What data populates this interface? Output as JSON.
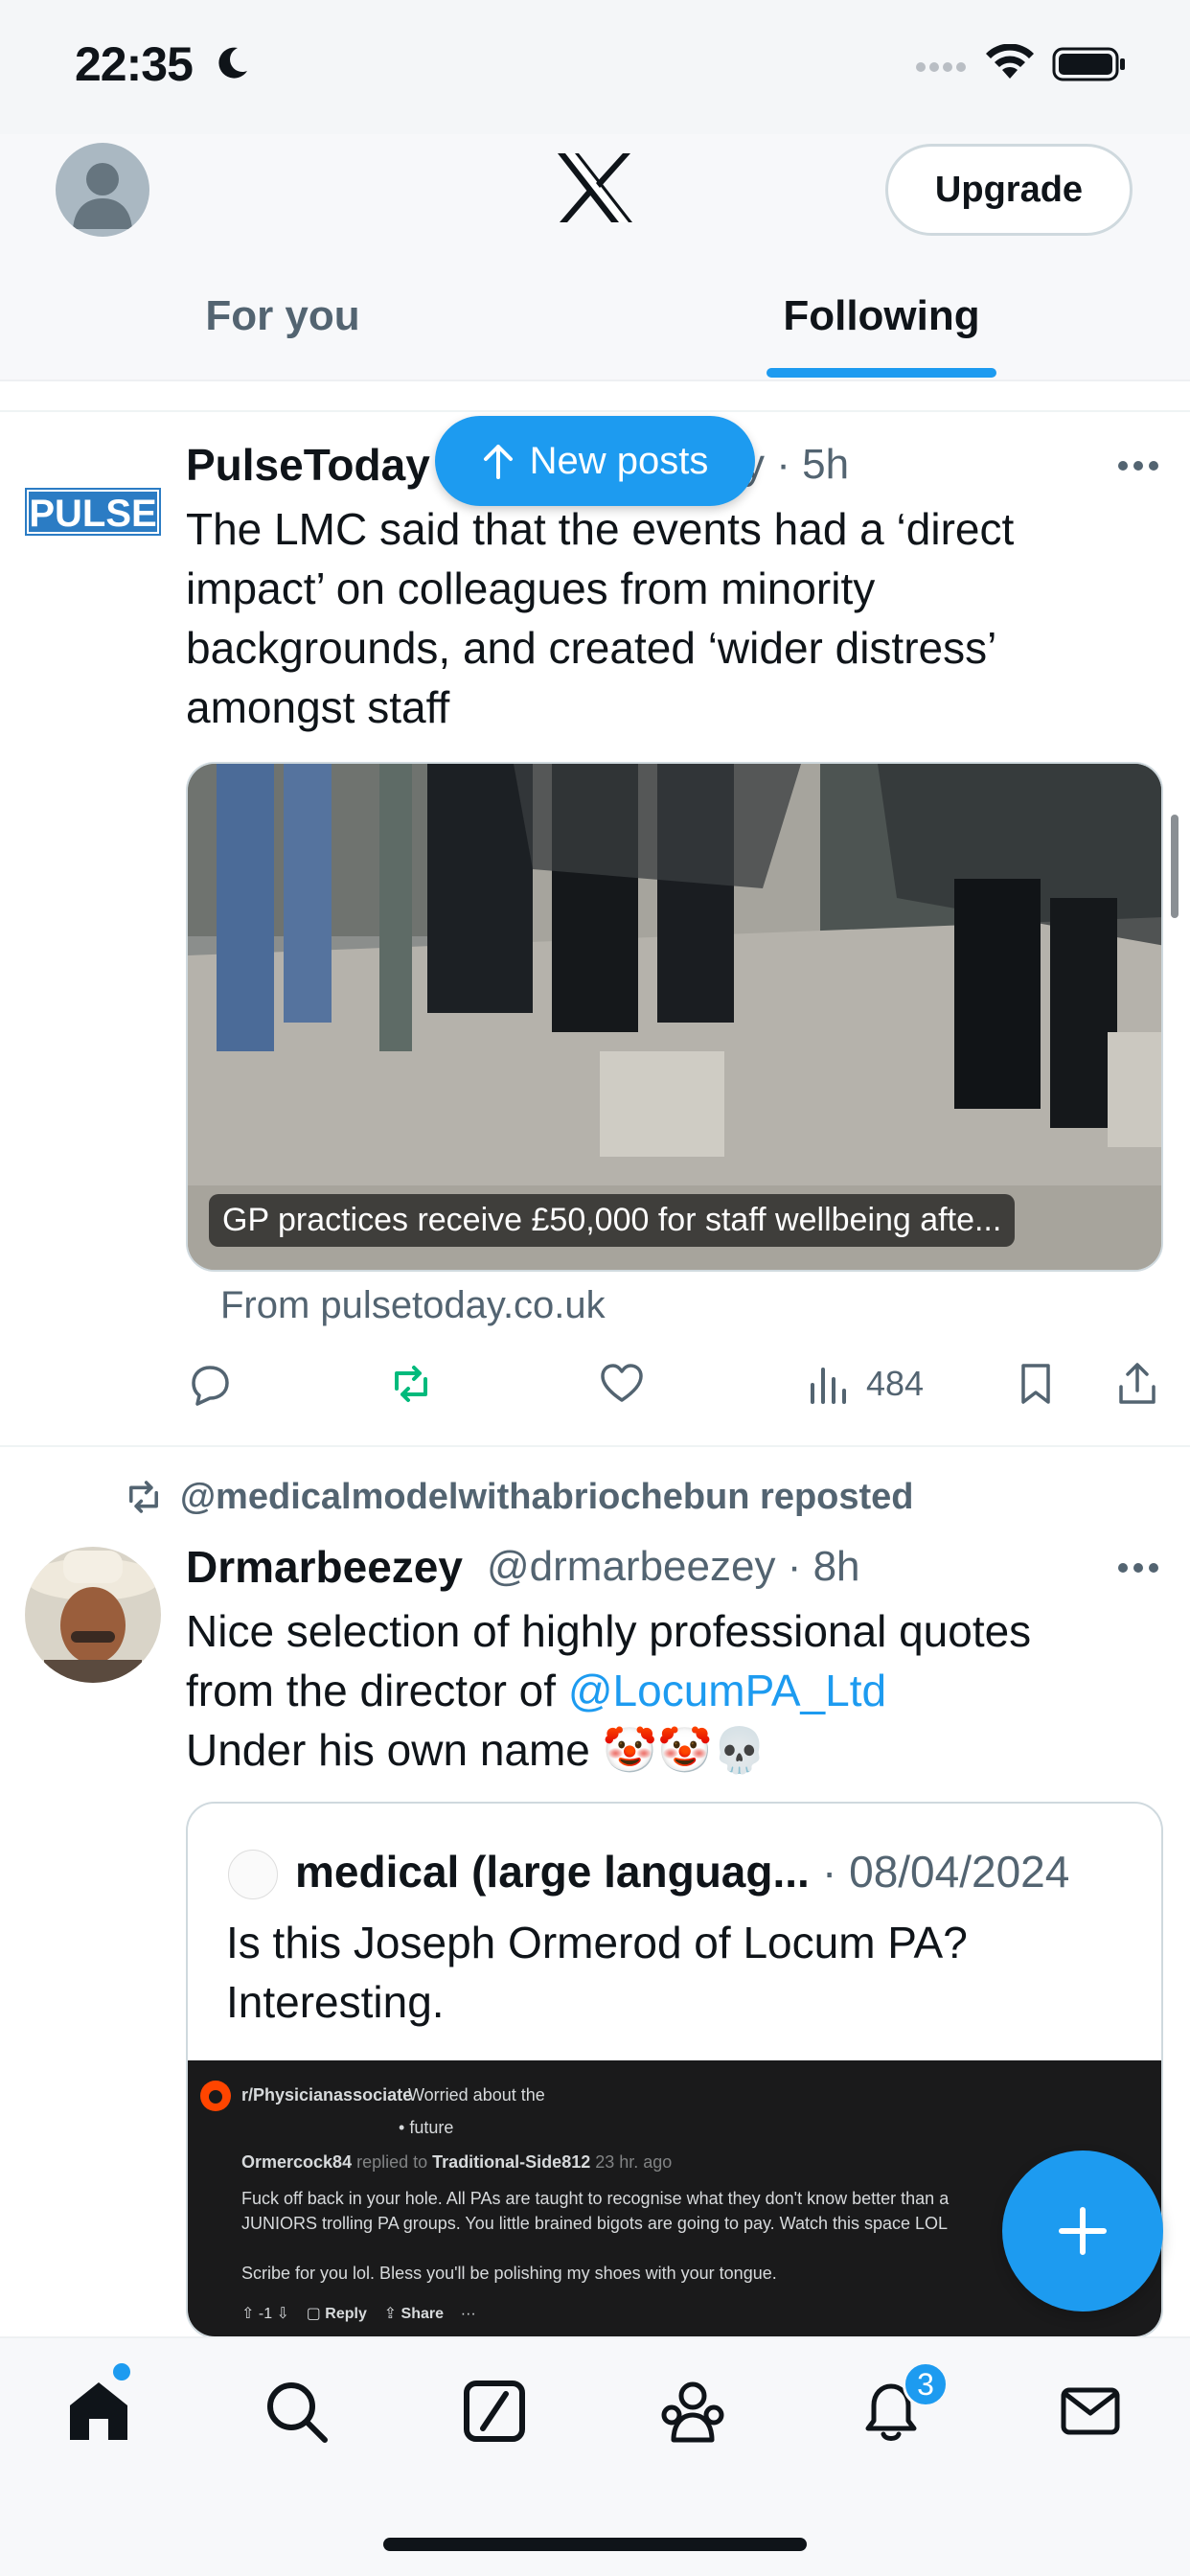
{
  "status_bar": {
    "time": "22:35"
  },
  "header": {
    "upgrade_label": "Upgrade",
    "tabs": [
      {
        "label": "For you",
        "selected": false
      },
      {
        "label": "Following",
        "selected": true
      }
    ]
  },
  "new_posts_label": "New posts",
  "tweets": [
    {
      "display_name": "PulseToday",
      "handle_partial": "y",
      "time": "5h",
      "text": "The LMC said that the events had a ‘direct impact’ on colleagues from minority backgrounds, and created ‘wider distress’ amongst staff",
      "avatar_text": "PULSE",
      "media_caption": "GP practices receive £50,000 for staff wellbeing afte...",
      "from_link": "From pulsetoday.co.uk",
      "views": "484"
    },
    {
      "reposted_by": "@medicalmodelwithabriochebun reposted",
      "display_name": "Drmarbeezey",
      "handle": "@drmarbeezey",
      "time": "8h",
      "text_line1": "Nice selection of highly professional quotes",
      "text_line2_prefix": "from the director of ",
      "mention": "@LocumPA_Ltd",
      "text_line3": "Under his own name 🤡🤡💀",
      "quote": {
        "display_name": "medical (large languag...",
        "date": "08/04/2024",
        "text": "Is this Joseph Ormerod of Locum PA? Interesting.",
        "screenshot": {
          "subreddit": "r/Physicianassociate",
          "thread_title_1": "Worried about the",
          "thread_title_2": "future",
          "user": "Ormercock84",
          "replied_to_prefix": "replied to",
          "replied_to": "Traditional-Side812",
          "age": "23 hr. ago",
          "body_1": "Fuck off back in your hole. All PAs are taught to recognise what they don't know better than a",
          "body_2": "JUNIORS trolling PA groups. You little brained bigots are going to pay. Watch this space LOL",
          "body_3": "Scribe for you lol. Bless you'll be polishing my shoes with your tongue.",
          "score": "-1",
          "reply_label": "Reply",
          "share_label": "Share"
        }
      }
    }
  ],
  "tab_bar": {
    "notification_count": "3",
    "items": [
      "home-icon",
      "search-icon",
      "grok-icon",
      "communities-icon",
      "notifications-icon",
      "messages-icon"
    ]
  },
  "colors": {
    "accent": "#1d9bf0",
    "repost_green": "#00ba7c",
    "text_secondary": "#536471"
  }
}
